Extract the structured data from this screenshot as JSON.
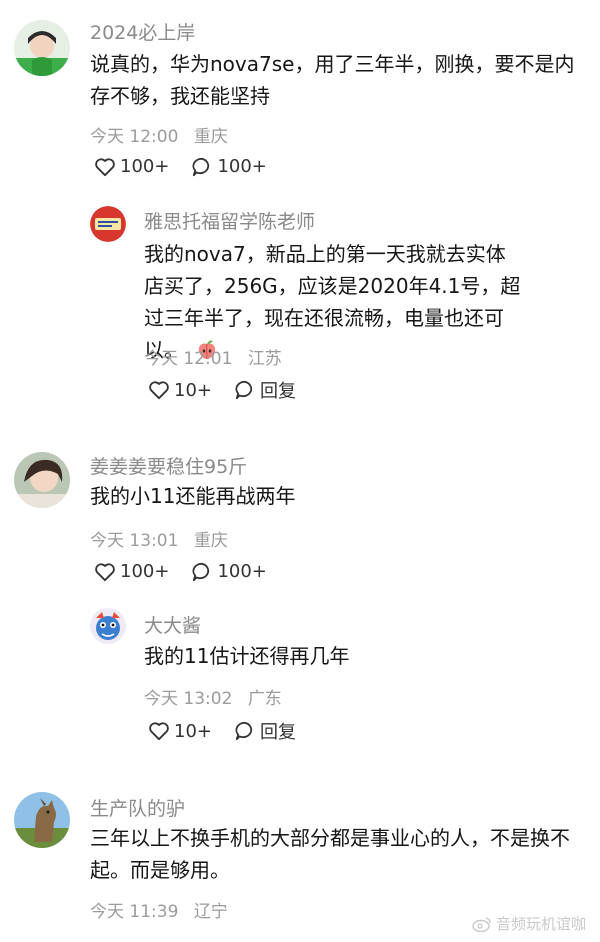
{
  "comments": [
    {
      "username": "2024必上岸",
      "text": "说真的，华为nova7se，用了三年半，刚换，要不是内存不够，我还能坚持",
      "time": "今天 12:00",
      "location": "重庆",
      "likes": "100+",
      "replies": "100+",
      "reply": {
        "username": "雅思托福留学陈老师",
        "text": "我的nova7，新品上的第一天我就去实体店买了，256G，应该是2020年4.1号，超过三年半了，现在还很流畅，电量也还可以。",
        "emoji": "peach-emoji",
        "time": "今天 12:01",
        "location": "江苏",
        "likes": "10+",
        "reply_label": "回复"
      }
    },
    {
      "username": "姜姜姜要稳住95斤",
      "text": "我的小11还能再战两年",
      "time": "今天 13:01",
      "location": "重庆",
      "likes": "100+",
      "replies": "100+",
      "reply": {
        "username": "大大酱",
        "text": "我的11估计还得再几年",
        "time": "今天 13:02",
        "location": "广东",
        "likes": "10+",
        "reply_label": "回复"
      }
    },
    {
      "username": "生产队的驴",
      "text": "三年以上不换手机的大部分都是事业心的人，不是换不起。而是够用。",
      "time": "今天 11:39",
      "location": "辽宁"
    }
  ],
  "watermark": "音频玩机谊咖",
  "colors": {
    "text": "#161616",
    "meta": "#9b9b9b",
    "name": "#8a8a8a"
  }
}
